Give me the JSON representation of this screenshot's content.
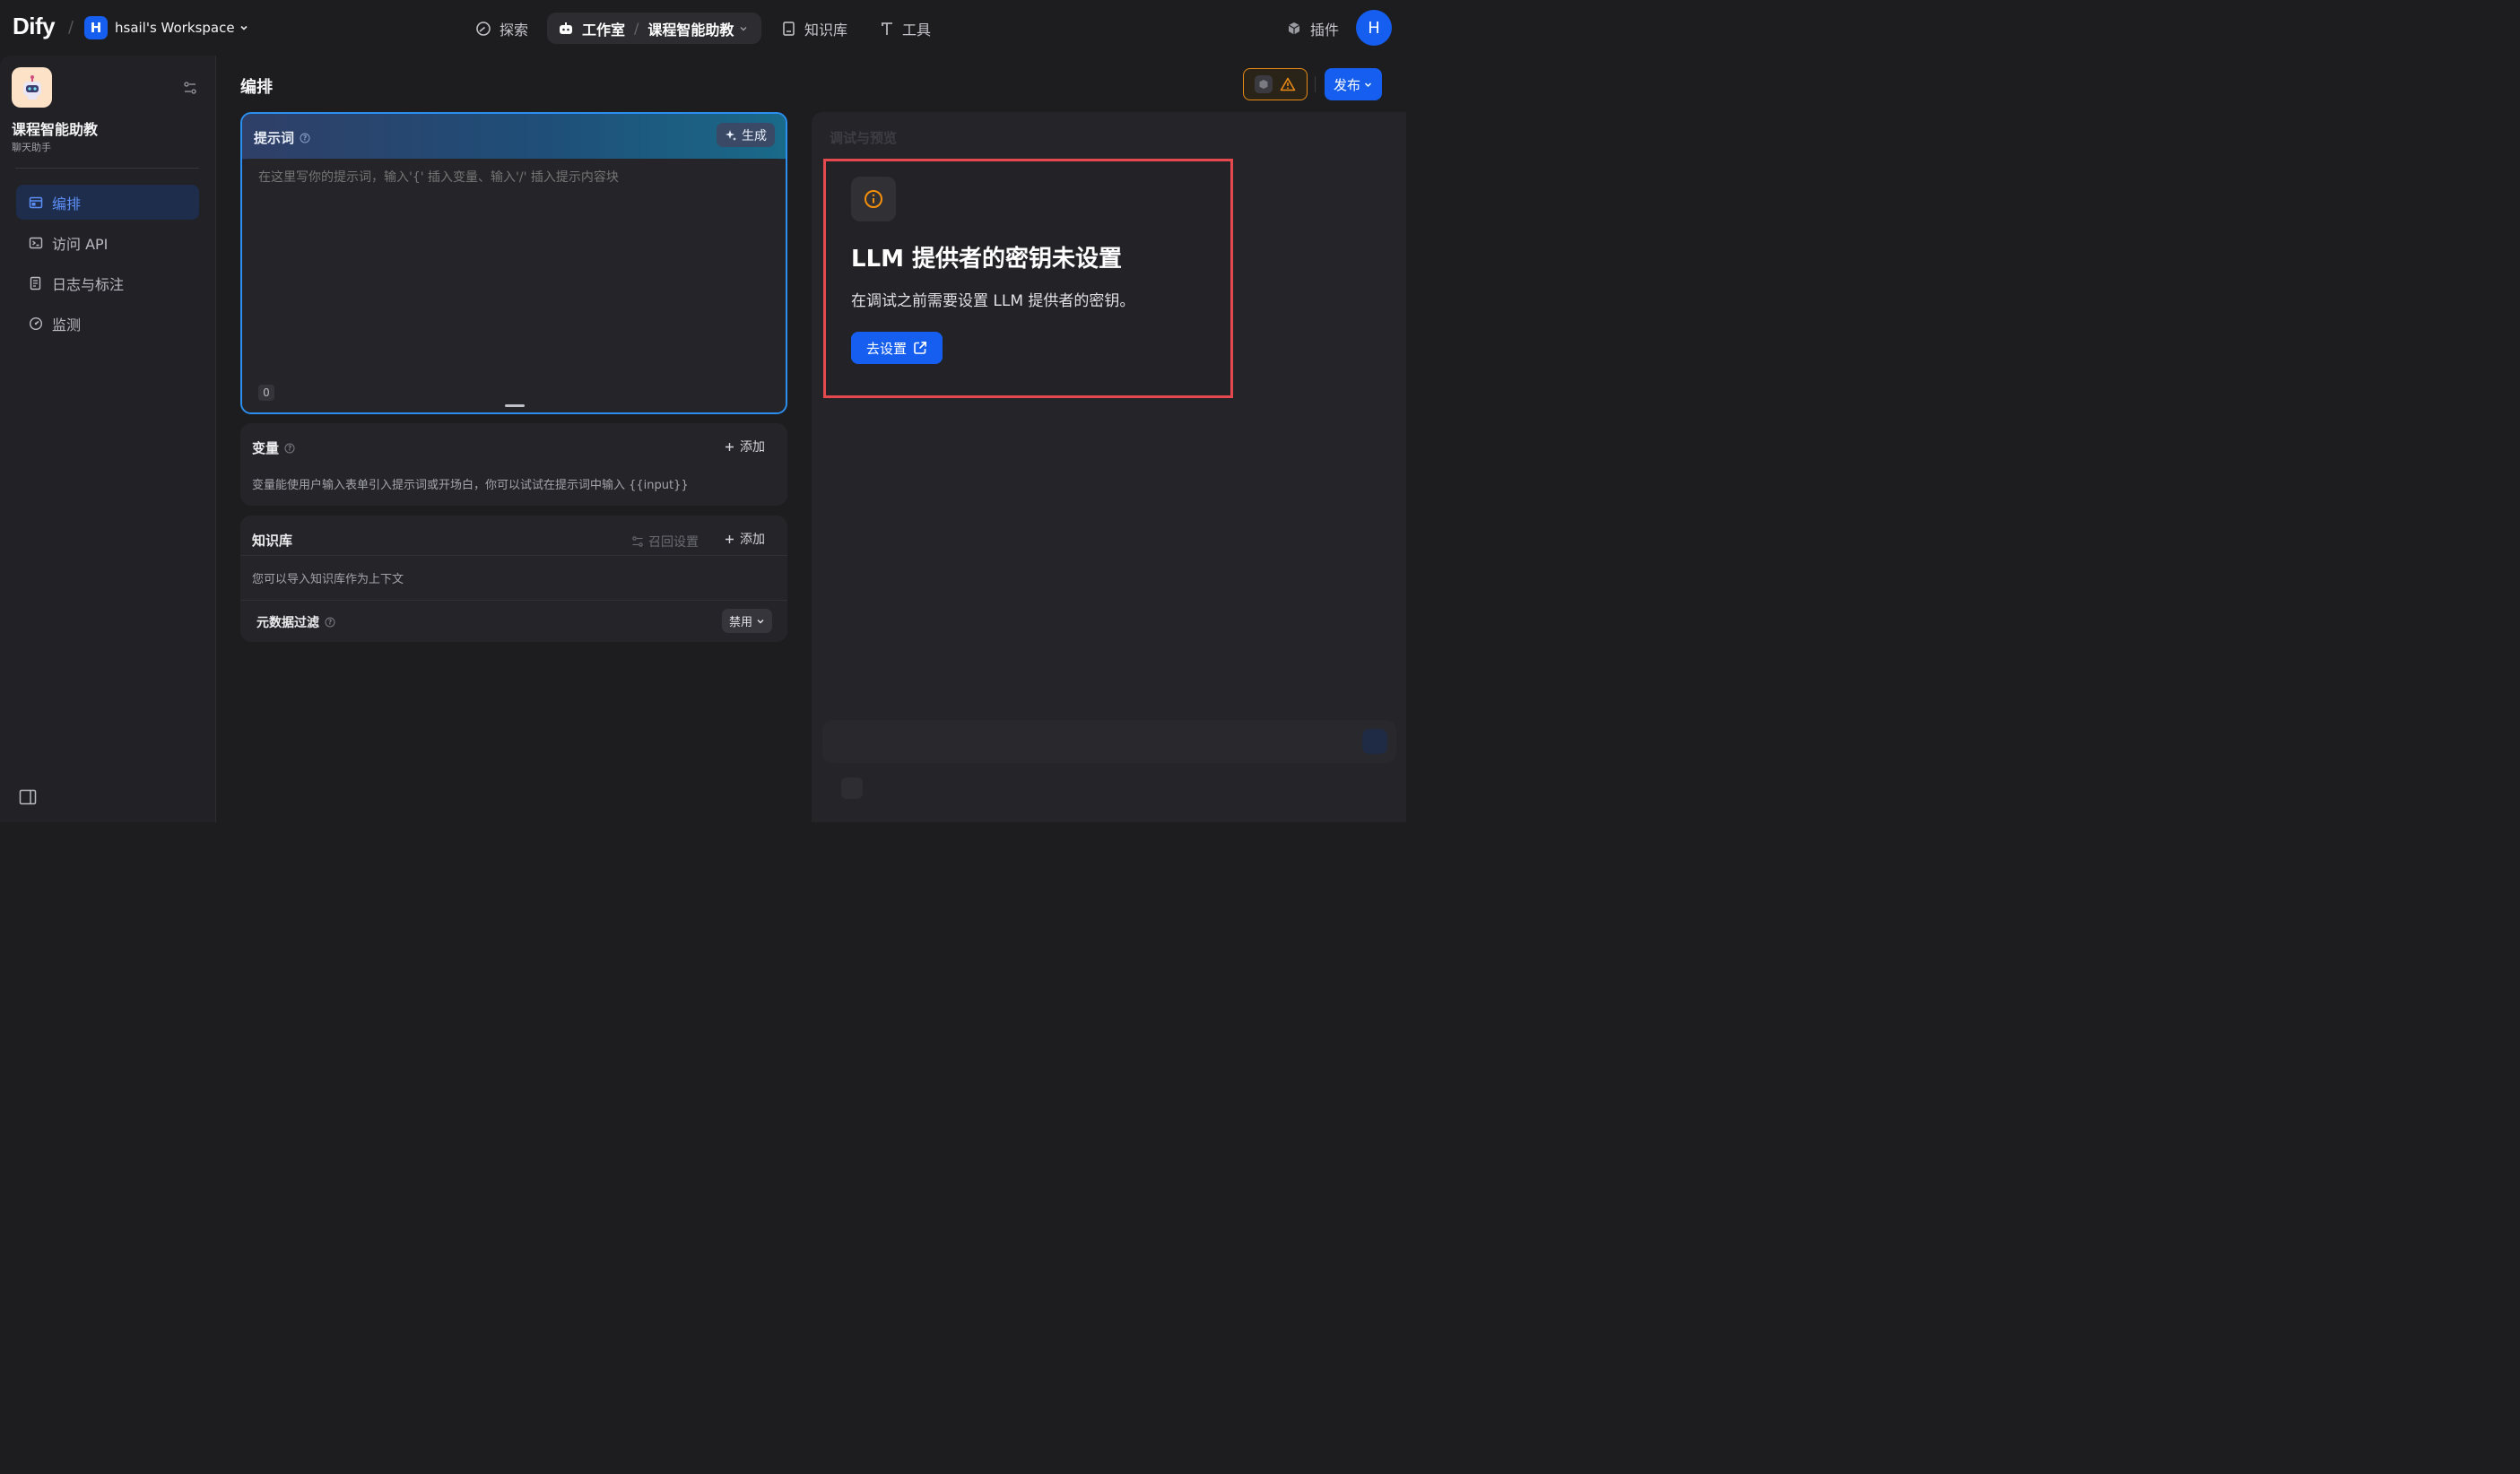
{
  "brand": {
    "logo": "Dify",
    "separator": "/",
    "workspace_initial": "H",
    "workspace_name": "hsail's Workspace"
  },
  "nav": {
    "explore": "探索",
    "studio": "工作室",
    "studio_separator": "/",
    "app_name": "课程智能助教",
    "knowledge": "知识库",
    "tools": "工具",
    "plugins": "插件",
    "user_initial": "H"
  },
  "sidebar": {
    "app_name": "课程智能助教",
    "app_type": "聊天助手",
    "items": [
      {
        "label": "编排",
        "icon": "layout-icon",
        "active": true
      },
      {
        "label": "访问 API",
        "icon": "terminal-icon",
        "active": false
      },
      {
        "label": "日志与标注",
        "icon": "log-icon",
        "active": false
      },
      {
        "label": "监测",
        "icon": "gauge-icon",
        "active": false
      }
    ]
  },
  "orchestrate": {
    "title": "编排",
    "prompt": {
      "title": "提示词",
      "generate_label": "生成",
      "placeholder": "在这里写你的提示词，输入'{' 插入变量、输入'/' 插入提示内容块",
      "char_count": "0"
    },
    "variables": {
      "title": "变量",
      "add_label": "添加",
      "description": "变量能使用户输入表单引入提示词或开场白，你可以试试在提示词中输入 {{input}}"
    },
    "knowledge": {
      "title": "知识库",
      "recall_label": "召回设置",
      "add_label": "添加",
      "description": "您可以导入知识库作为上下文",
      "metadata_filter_label": "元数据过滤",
      "metadata_filter_value": "禁用"
    }
  },
  "header_actions": {
    "publish_label": "发布"
  },
  "debug": {
    "title": "调试与预览",
    "alert": {
      "title": "LLM 提供者的密钥未设置",
      "description": "在调试之前需要设置 LLM 提供者的密钥。",
      "button_label": "去设置"
    }
  },
  "colors": {
    "accent": "#155eef",
    "warning": "#e88a14",
    "highlight_border": "#e5484d",
    "background": "#1d1d20"
  }
}
